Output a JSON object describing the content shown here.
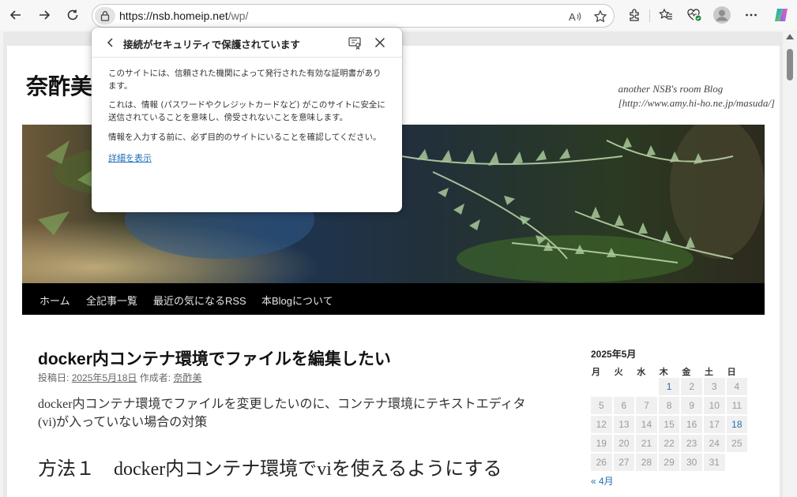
{
  "browser": {
    "url_host": "https://nsb.homeip.net",
    "url_path": "/wp/",
    "icons": [
      "back-arrow-icon",
      "forward-arrow-icon",
      "refresh-icon",
      "lock-icon",
      "read-aloud-icon",
      "favorite-star-icon",
      "extensions-icon",
      "favorites-icon",
      "heart-pulse-icon",
      "profile-icon",
      "more-icon",
      "copilot-icon"
    ]
  },
  "site": {
    "title_visible": "奈酢美",
    "description_line1": "another NSB's room Blog",
    "description_line2": "[http://www.amy.hi-ho.ne.jp/masuda/]"
  },
  "nav": {
    "items": [
      "ホーム",
      "全記事一覧",
      "最近の気になるRSS",
      "本Blogについて"
    ]
  },
  "post": {
    "title": "docker内コンテナ環境でファイルを編集したい",
    "meta_posted_label": "投稿日:",
    "meta_date": "2025年5月18日",
    "meta_author_label": "作成者:",
    "meta_author": "奈酢美",
    "body": "docker内コンテナ環境でファイルを変更したいのに、コンテナ環境にテキストエディタ(vi)が入っていない場合の対策",
    "heading": "方法１　docker内コンテナ環境でviを使えるようにする"
  },
  "calendar": {
    "title": "2025年5月",
    "weekdays": [
      "月",
      "火",
      "水",
      "木",
      "金",
      "土",
      "日"
    ],
    "days": [
      "",
      "",
      "",
      "1",
      "2",
      "3",
      "4",
      "5",
      "6",
      "7",
      "8",
      "9",
      "10",
      "11",
      "12",
      "13",
      "14",
      "15",
      "16",
      "17",
      "18",
      "19",
      "20",
      "21",
      "22",
      "23",
      "24",
      "25",
      "26",
      "27",
      "28",
      "29",
      "30",
      "31",
      ""
    ],
    "linked_days": [
      "1",
      "18"
    ],
    "prev_month": "« 4月"
  },
  "security_popup": {
    "title": "接続がセキュリティで保護されています",
    "para1": "このサイトには、信頼された機関によって発行された有効な証明書があります。",
    "para2": "これは、情報 (パスワードやクレジットカードなど) がこのサイトに安全に送信されていることを意味し、傍受されないことを意味します。",
    "para3": "情報を入力する前に、必ず目的のサイトにいることを確認してください。",
    "details_link": "詳細を表示"
  },
  "colors": {
    "link": "#1f6fb5",
    "nav_bg": "#000000",
    "nav_text": "#e6e6e6"
  }
}
